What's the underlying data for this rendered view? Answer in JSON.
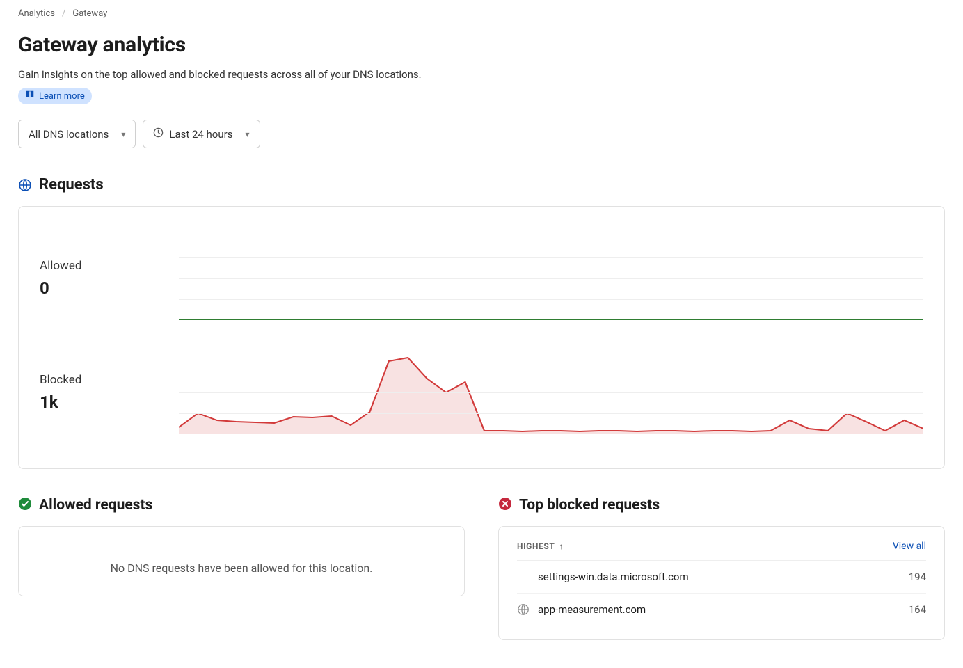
{
  "breadcrumb": {
    "parent": "Analytics",
    "current": "Gateway"
  },
  "header": {
    "title": "Gateway analytics",
    "subtitle": "Gain insights on the top allowed and blocked requests across all of your DNS locations.",
    "learn_more": "Learn more"
  },
  "filters": {
    "locations_label": "All DNS locations",
    "time_label": "Last 24 hours"
  },
  "requests_section_title": "Requests",
  "allowed_label": "Allowed",
  "allowed_value": "0",
  "blocked_label": "Blocked",
  "blocked_value": "1k",
  "allowed_requests_title": "Allowed requests",
  "allowed_empty_msg": "No DNS requests have been allowed for this location.",
  "top_blocked_title": "Top blocked requests",
  "top_blocked_highest": "HIGHEST",
  "top_blocked_viewall": "View all",
  "top_blocked": {
    "items": [
      {
        "domain": "settings-win.data.microsoft.com",
        "count": "194",
        "show_globe": false
      },
      {
        "domain": "app-measurement.com",
        "count": "164",
        "show_globe": true
      }
    ]
  },
  "chart_data": [
    {
      "type": "area",
      "title": "Allowed",
      "ylabel": "requests",
      "ylim": [
        0,
        100
      ],
      "x_points": 40,
      "series": [
        {
          "name": "Allowed",
          "color": "#2f7d32",
          "values": [
            0,
            0,
            0,
            0,
            0,
            0,
            0,
            0,
            0,
            0,
            0,
            0,
            0,
            0,
            0,
            0,
            0,
            0,
            0,
            0,
            0,
            0,
            0,
            0,
            0,
            0,
            0,
            0,
            0,
            0,
            0,
            0,
            0,
            0,
            0,
            0,
            0,
            0,
            0,
            0
          ]
        }
      ]
    },
    {
      "type": "area",
      "title": "Blocked",
      "ylabel": "requests",
      "ylim": [
        0,
        120
      ],
      "x_points": 40,
      "series": [
        {
          "name": "Blocked",
          "color": "#d23a3a",
          "values": [
            10,
            30,
            20,
            18,
            17,
            16,
            25,
            24,
            26,
            13,
            32,
            105,
            110,
            80,
            60,
            75,
            5,
            5,
            4,
            5,
            5,
            4,
            5,
            5,
            4,
            5,
            5,
            4,
            5,
            5,
            4,
            5,
            20,
            8,
            5,
            30,
            18,
            5,
            20,
            8
          ]
        }
      ]
    }
  ]
}
